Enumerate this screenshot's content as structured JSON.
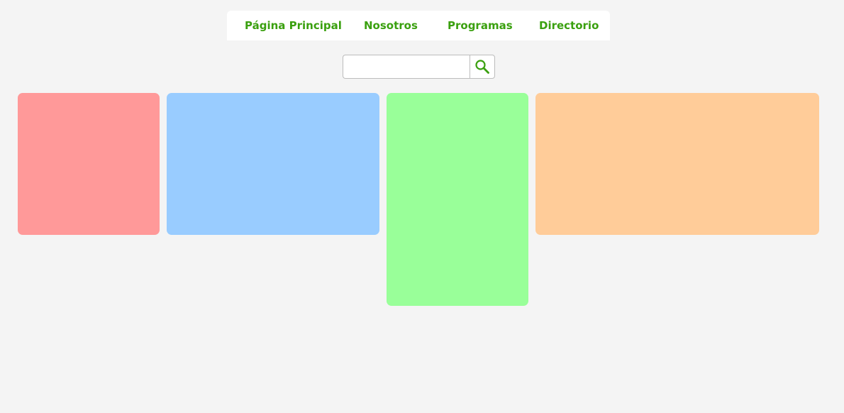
{
  "nav": {
    "items": [
      {
        "label": "Página Principal"
      },
      {
        "label": "Nosotros"
      },
      {
        "label": "Programas"
      },
      {
        "label": "Directorio"
      }
    ]
  },
  "search": {
    "value": "",
    "placeholder": "",
    "button_icon": "search-icon"
  },
  "tiles": [
    {
      "name": "red",
      "color": "#ff9999"
    },
    {
      "name": "blue",
      "color": "#99ccff"
    },
    {
      "name": "green",
      "color": "#99ff99"
    },
    {
      "name": "orange",
      "color": "#ffcc99"
    }
  ],
  "colors": {
    "accent": "#3aa00f",
    "background": "#f4f4f4",
    "nav_background": "#ffffff"
  }
}
